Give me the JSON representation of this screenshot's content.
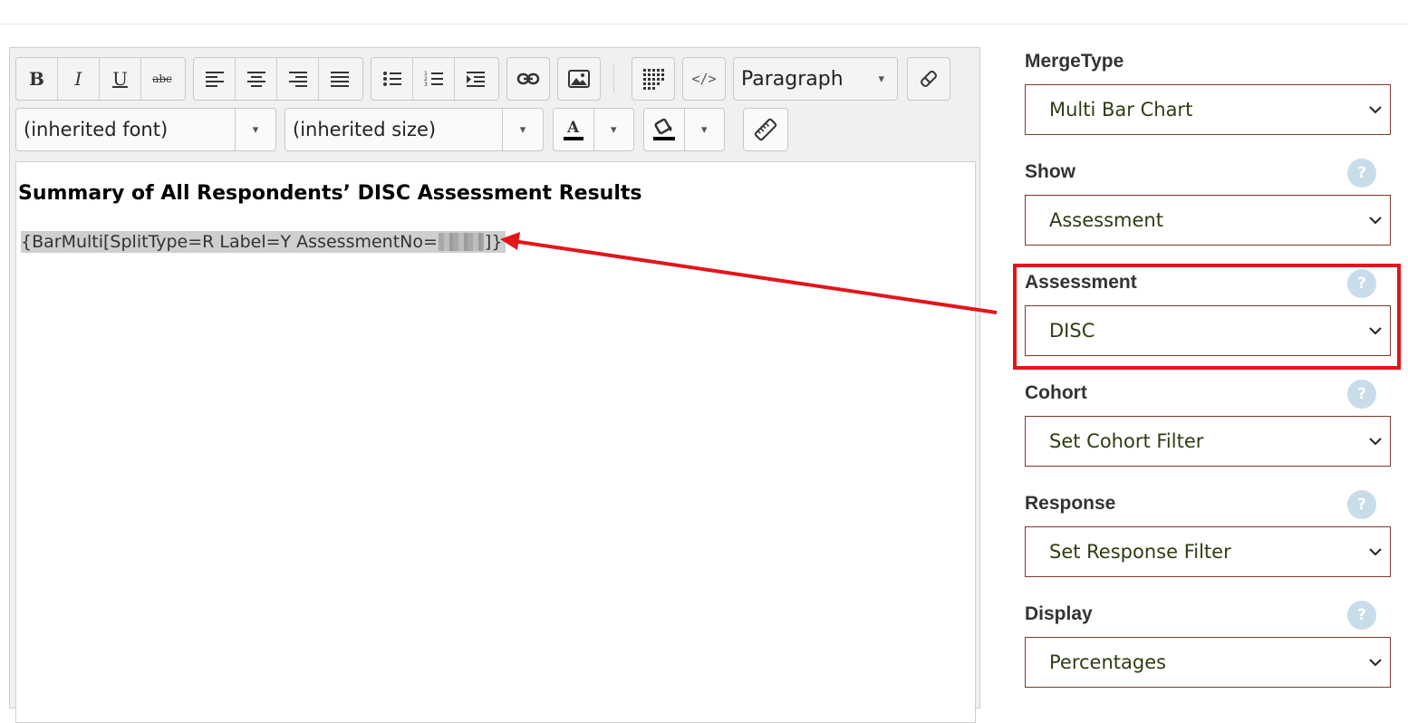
{
  "editor": {
    "toolbar": {
      "paragraph_format": "Paragraph",
      "font_family": "(inherited font)",
      "font_size": "(inherited size)"
    },
    "content": {
      "heading": "Summary of All Respondents’ DISC Assessment Results",
      "merge_prefix": "{BarMulti[SplitType=R Label=Y AssessmentNo=",
      "merge_suffix": "]}"
    }
  },
  "panel": {
    "fields": [
      {
        "label": "MergeType",
        "value": "Multi Bar Chart"
      },
      {
        "label": "Show",
        "value": "Assessment"
      },
      {
        "label": "Assessment",
        "value": "DISC"
      },
      {
        "label": "Cohort",
        "value": "Set Cohort Filter"
      },
      {
        "label": "Response",
        "value": "Set Response Filter"
      },
      {
        "label": "Display",
        "value": "Percentages"
      }
    ],
    "help_glyph": "?"
  },
  "icons": {
    "dropdown_arrow": "▾",
    "select_chevron": "chevron-down-icon"
  },
  "colors": {
    "highlight": "#e3151b",
    "select_border": "#7a3a2a",
    "select_text": "#2f3d12",
    "help_bg": "#c9dcea"
  }
}
